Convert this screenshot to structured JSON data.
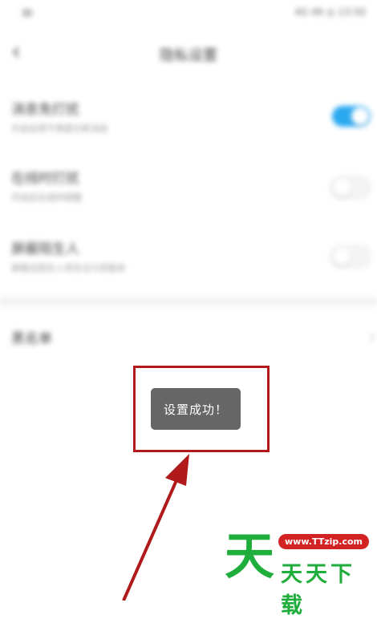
{
  "status_bar": {
    "right_text": "4G 46 ◎ 13:50"
  },
  "header": {
    "back_glyph": "‹",
    "title": "隐私设置"
  },
  "settings": [
    {
      "title": "消息免打扰",
      "subtitle": "开启后将不再提示新消息",
      "state": "on"
    },
    {
      "title": "在线时打扰",
      "subtitle": "开启后在线时提醒",
      "state": "off"
    },
    {
      "title": "屏蔽陌生人",
      "subtitle": "屏蔽后陌生人将无法与您联系",
      "state": "off"
    }
  ],
  "blacklist": {
    "label": "黑名单",
    "chevron": "›"
  },
  "toast": {
    "message": "设置成功！"
  },
  "annotation": {
    "color": "#b01a1a"
  },
  "watermark": {
    "big_char": "天",
    "url": "www.TTzip.com",
    "text": "天天下载",
    "green": "#1fae3c",
    "red": "#d22222"
  }
}
